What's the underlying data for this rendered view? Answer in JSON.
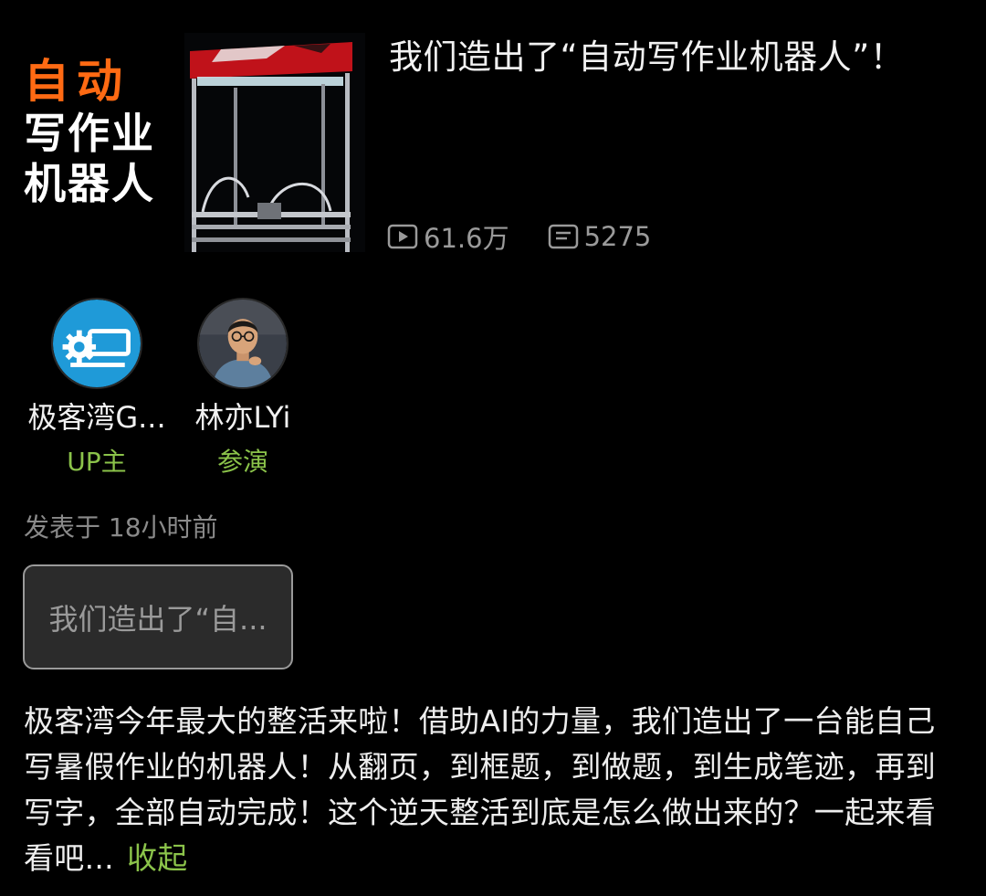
{
  "video": {
    "thumbnail_text": {
      "line1": "自动",
      "line2": "写作业",
      "line3": "机器人"
    },
    "title": "我们造出了“自动写作业机器人”！",
    "views": "61.6万",
    "comments": "5275"
  },
  "creators": [
    {
      "name": "极客湾G...",
      "role": "UP主",
      "avatar": "gear-logo"
    },
    {
      "name": "林亦LYi",
      "role": "参演",
      "avatar": "person-photo"
    }
  ],
  "post_time": "发表于 18小时前",
  "title_chip": "我们造出了“自...",
  "description": "极客湾今年最大的整活来啦！借助AI的力量，我们造出了一台能自己写暑假作业的机器人！从翻页，到框题，到做题，到生成笔迹，再到写字，全部自动完成！这个逆天整活到底是怎么做出来的？一起来看看吧...",
  "collapse_label": "收起",
  "colors": {
    "accent_green": "#8bc34a",
    "thumb_orange": "#ff6a13",
    "background": "#000000"
  }
}
